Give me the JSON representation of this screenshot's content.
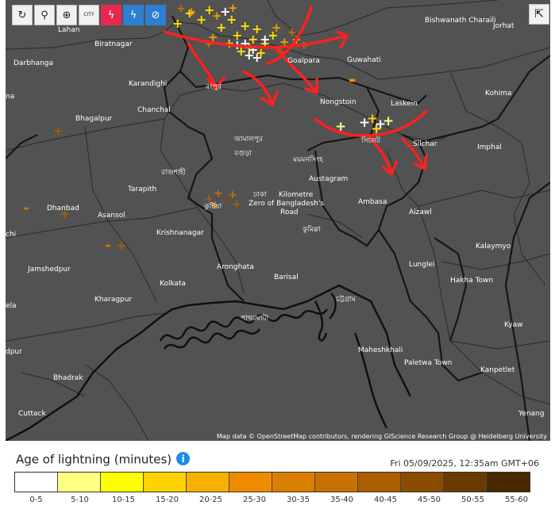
{
  "toolbar": {
    "city_label": "CITY"
  },
  "map": {
    "labels": [
      {
        "id": "lahan",
        "text": "Lahan"
      },
      {
        "id": "biratnagar",
        "text": "Biratnagar"
      },
      {
        "id": "darbhanga",
        "text": "Darbhanga"
      },
      {
        "id": "karandighi",
        "text": "Karandighi"
      },
      {
        "id": "na",
        "text": "na"
      },
      {
        "id": "chanchal",
        "text": "Chanchal"
      },
      {
        "id": "bhagalpur",
        "text": "Bhagalpur"
      },
      {
        "id": "goalpara",
        "text": "Goalpara"
      },
      {
        "id": "guwahati",
        "text": "Guwahati"
      },
      {
        "id": "nongstoin",
        "text": "Nongstoin"
      },
      {
        "id": "laskein",
        "text": "Laskein"
      },
      {
        "id": "bishwanath",
        "text": "Bishwanath\nCharaili"
      },
      {
        "id": "jorhat",
        "text": "Jorhat"
      },
      {
        "id": "kohima",
        "text": "Kohima"
      },
      {
        "id": "silchar",
        "text": "Silchar"
      },
      {
        "id": "imphal",
        "text": "Imphal"
      },
      {
        "id": "rangpur",
        "text": "রংপুর"
      },
      {
        "id": "jamalpur",
        "text": "জামালপুর"
      },
      {
        "id": "bogura",
        "text": "বগুড়া"
      },
      {
        "id": "mymensingh",
        "text": "ময়মনসিংহ"
      },
      {
        "id": "sylhet",
        "text": "সিলেট"
      },
      {
        "id": "rajshahi",
        "text": "রাজশাহী"
      },
      {
        "id": "tarapith",
        "text": "Tarapith"
      },
      {
        "id": "austagram",
        "text": "Austagram"
      },
      {
        "id": "dhaka",
        "text": "ঢাকা"
      },
      {
        "id": "zero",
        "text": "Kilometre\nZero of Bangladesh's\nRoad"
      },
      {
        "id": "ambasa",
        "text": "Ambasa"
      },
      {
        "id": "dhanbad",
        "text": "Dhanbad"
      },
      {
        "id": "asansol",
        "text": "Asansol"
      },
      {
        "id": "kushtia",
        "text": "কুষ্টিয়া"
      },
      {
        "id": "aizawl",
        "text": "Aizawl"
      },
      {
        "id": "chi",
        "text": "chi"
      },
      {
        "id": "krishnanagar",
        "text": "Krishnanagar"
      },
      {
        "id": "comilla",
        "text": "কুমিল্লা"
      },
      {
        "id": "kalaymyo",
        "text": "Kalaymyo"
      },
      {
        "id": "jamshedpur",
        "text": "Jamshedpur"
      },
      {
        "id": "aronghata",
        "text": "Aronghata"
      },
      {
        "id": "lunglei",
        "text": "Lunglei"
      },
      {
        "id": "barisal",
        "text": "Barisal"
      },
      {
        "id": "hakha",
        "text": "Hakha Town"
      },
      {
        "id": "kolkata",
        "text": "Kolkata"
      },
      {
        "id": "kharagpur",
        "text": "Kharagpur"
      },
      {
        "id": "chattogram",
        "text": "চট্টগ্রাম"
      },
      {
        "id": "ela",
        "text": "ela"
      },
      {
        "id": "patharghata",
        "text": "পাথরঘাটা"
      },
      {
        "id": "kyaw",
        "text": "Kyaw"
      },
      {
        "id": "dpur",
        "text": "dpur"
      },
      {
        "id": "maheshkhali",
        "text": "Maheshkhali"
      },
      {
        "id": "paletwa",
        "text": "Paletwa Town"
      },
      {
        "id": "kanpetlet",
        "text": "Kanpetlet"
      },
      {
        "id": "bhadrak",
        "text": "Bhadrak"
      },
      {
        "id": "cuttack",
        "text": "Cuttack"
      },
      {
        "id": "yenang",
        "text": "Yenang"
      }
    ],
    "attribution": "Map data © OpenStreetMap contributors, rendering GIScience Research Group @ Heidelberg University"
  },
  "legend": {
    "title": "Age of lightning (minutes)",
    "info_icon": "i",
    "timestamp": "Fri 05/09/2025, 12:35am GMT+06",
    "bins": [
      {
        "label": "0-5",
        "color": "#ffffff"
      },
      {
        "label": "5-10",
        "color": "#ffff80"
      },
      {
        "label": "10-15",
        "color": "#ffff00"
      },
      {
        "label": "15-20",
        "color": "#ffd200"
      },
      {
        "label": "20-25",
        "color": "#f7b000"
      },
      {
        "label": "25-30",
        "color": "#f08a00"
      },
      {
        "label": "30-35",
        "color": "#dc7e00"
      },
      {
        "label": "35-40",
        "color": "#c87000"
      },
      {
        "label": "40-45",
        "color": "#aa5e00"
      },
      {
        "label": "45-50",
        "color": "#8a4c00"
      },
      {
        "label": "50-55",
        "color": "#6a3b00"
      },
      {
        "label": "55-60",
        "color": "#4a2800"
      }
    ]
  },
  "colors": {
    "map_bg": "#525252",
    "arrow": "#ff2020",
    "border": "#1a1a1a"
  }
}
